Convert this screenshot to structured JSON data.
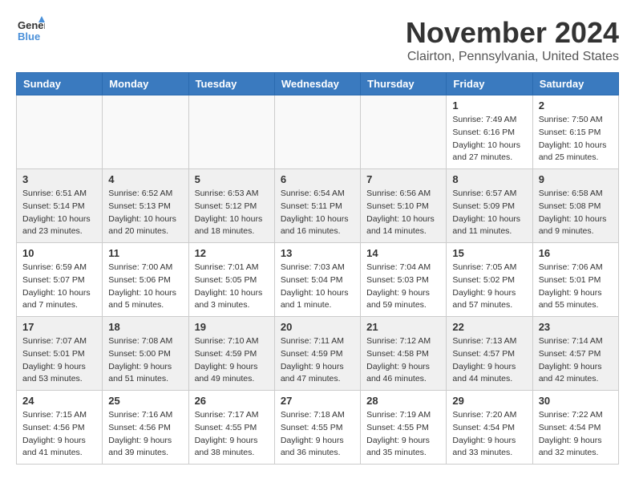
{
  "logo": {
    "line1": "General",
    "line2": "Blue"
  },
  "title": "November 2024",
  "location": "Clairton, Pennsylvania, United States",
  "weekdays": [
    "Sunday",
    "Monday",
    "Tuesday",
    "Wednesday",
    "Thursday",
    "Friday",
    "Saturday"
  ],
  "weeks": [
    [
      {
        "day": "",
        "info": "",
        "empty": true
      },
      {
        "day": "",
        "info": "",
        "empty": true
      },
      {
        "day": "",
        "info": "",
        "empty": true
      },
      {
        "day": "",
        "info": "",
        "empty": true
      },
      {
        "day": "",
        "info": "",
        "empty": true
      },
      {
        "day": "1",
        "info": "Sunrise: 7:49 AM\nSunset: 6:16 PM\nDaylight: 10 hours\nand 27 minutes."
      },
      {
        "day": "2",
        "info": "Sunrise: 7:50 AM\nSunset: 6:15 PM\nDaylight: 10 hours\nand 25 minutes."
      }
    ],
    [
      {
        "day": "3",
        "info": "Sunrise: 6:51 AM\nSunset: 5:14 PM\nDaylight: 10 hours\nand 23 minutes.",
        "shaded": true
      },
      {
        "day": "4",
        "info": "Sunrise: 6:52 AM\nSunset: 5:13 PM\nDaylight: 10 hours\nand 20 minutes.",
        "shaded": true
      },
      {
        "day": "5",
        "info": "Sunrise: 6:53 AM\nSunset: 5:12 PM\nDaylight: 10 hours\nand 18 minutes.",
        "shaded": true
      },
      {
        "day": "6",
        "info": "Sunrise: 6:54 AM\nSunset: 5:11 PM\nDaylight: 10 hours\nand 16 minutes.",
        "shaded": true
      },
      {
        "day": "7",
        "info": "Sunrise: 6:56 AM\nSunset: 5:10 PM\nDaylight: 10 hours\nand 14 minutes.",
        "shaded": true
      },
      {
        "day": "8",
        "info": "Sunrise: 6:57 AM\nSunset: 5:09 PM\nDaylight: 10 hours\nand 11 minutes.",
        "shaded": true
      },
      {
        "day": "9",
        "info": "Sunrise: 6:58 AM\nSunset: 5:08 PM\nDaylight: 10 hours\nand 9 minutes.",
        "shaded": true
      }
    ],
    [
      {
        "day": "10",
        "info": "Sunrise: 6:59 AM\nSunset: 5:07 PM\nDaylight: 10 hours\nand 7 minutes."
      },
      {
        "day": "11",
        "info": "Sunrise: 7:00 AM\nSunset: 5:06 PM\nDaylight: 10 hours\nand 5 minutes."
      },
      {
        "day": "12",
        "info": "Sunrise: 7:01 AM\nSunset: 5:05 PM\nDaylight: 10 hours\nand 3 minutes."
      },
      {
        "day": "13",
        "info": "Sunrise: 7:03 AM\nSunset: 5:04 PM\nDaylight: 10 hours\nand 1 minute."
      },
      {
        "day": "14",
        "info": "Sunrise: 7:04 AM\nSunset: 5:03 PM\nDaylight: 9 hours\nand 59 minutes."
      },
      {
        "day": "15",
        "info": "Sunrise: 7:05 AM\nSunset: 5:02 PM\nDaylight: 9 hours\nand 57 minutes."
      },
      {
        "day": "16",
        "info": "Sunrise: 7:06 AM\nSunset: 5:01 PM\nDaylight: 9 hours\nand 55 minutes."
      }
    ],
    [
      {
        "day": "17",
        "info": "Sunrise: 7:07 AM\nSunset: 5:01 PM\nDaylight: 9 hours\nand 53 minutes.",
        "shaded": true
      },
      {
        "day": "18",
        "info": "Sunrise: 7:08 AM\nSunset: 5:00 PM\nDaylight: 9 hours\nand 51 minutes.",
        "shaded": true
      },
      {
        "day": "19",
        "info": "Sunrise: 7:10 AM\nSunset: 4:59 PM\nDaylight: 9 hours\nand 49 minutes.",
        "shaded": true
      },
      {
        "day": "20",
        "info": "Sunrise: 7:11 AM\nSunset: 4:59 PM\nDaylight: 9 hours\nand 47 minutes.",
        "shaded": true
      },
      {
        "day": "21",
        "info": "Sunrise: 7:12 AM\nSunset: 4:58 PM\nDaylight: 9 hours\nand 46 minutes.",
        "shaded": true
      },
      {
        "day": "22",
        "info": "Sunrise: 7:13 AM\nSunset: 4:57 PM\nDaylight: 9 hours\nand 44 minutes.",
        "shaded": true
      },
      {
        "day": "23",
        "info": "Sunrise: 7:14 AM\nSunset: 4:57 PM\nDaylight: 9 hours\nand 42 minutes.",
        "shaded": true
      }
    ],
    [
      {
        "day": "24",
        "info": "Sunrise: 7:15 AM\nSunset: 4:56 PM\nDaylight: 9 hours\nand 41 minutes."
      },
      {
        "day": "25",
        "info": "Sunrise: 7:16 AM\nSunset: 4:56 PM\nDaylight: 9 hours\nand 39 minutes."
      },
      {
        "day": "26",
        "info": "Sunrise: 7:17 AM\nSunset: 4:55 PM\nDaylight: 9 hours\nand 38 minutes."
      },
      {
        "day": "27",
        "info": "Sunrise: 7:18 AM\nSunset: 4:55 PM\nDaylight: 9 hours\nand 36 minutes."
      },
      {
        "day": "28",
        "info": "Sunrise: 7:19 AM\nSunset: 4:55 PM\nDaylight: 9 hours\nand 35 minutes."
      },
      {
        "day": "29",
        "info": "Sunrise: 7:20 AM\nSunset: 4:54 PM\nDaylight: 9 hours\nand 33 minutes."
      },
      {
        "day": "30",
        "info": "Sunrise: 7:22 AM\nSunset: 4:54 PM\nDaylight: 9 hours\nand 32 minutes."
      }
    ]
  ]
}
